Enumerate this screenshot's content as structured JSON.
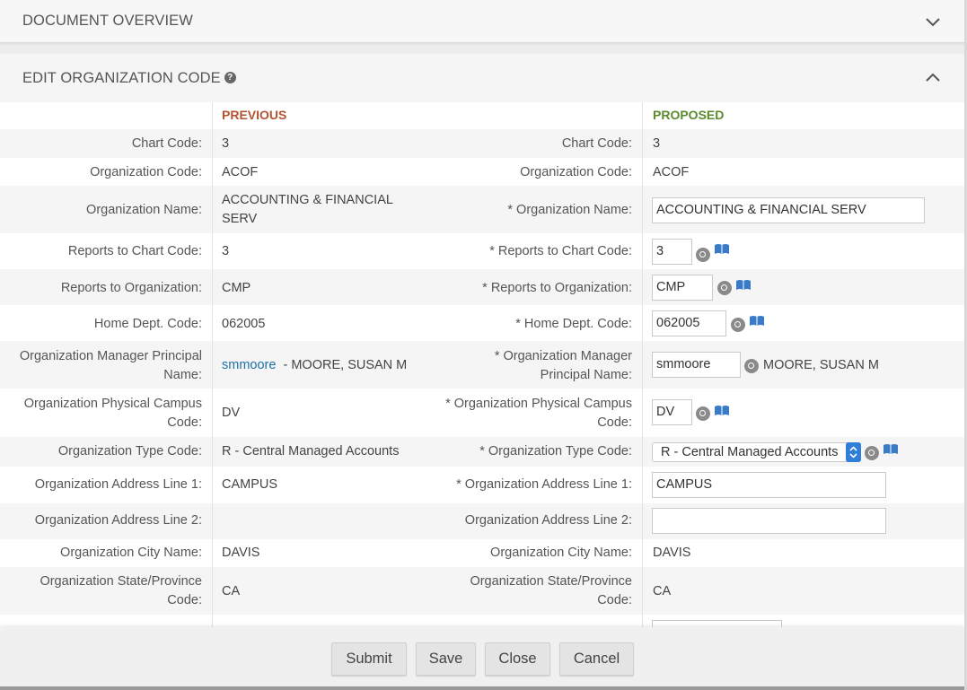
{
  "sections": {
    "document_overview": "DOCUMENT OVERVIEW",
    "edit_org": "EDIT ORGANIZATION CODE",
    "help_glyph": "?"
  },
  "columns": {
    "previous": "PREVIOUS",
    "proposed": "PROPOSED"
  },
  "rows": [
    {
      "label": "Chart Code:",
      "prev": "3",
      "plabel": "Chart Code:",
      "prop": "3"
    },
    {
      "label": "Organization Code:",
      "prev": "ACOF",
      "plabel": "Organization Code:",
      "prop": "ACOF"
    },
    {
      "label": "Organization Name:",
      "prev": "ACCOUNTING & FINANCIAL SERV",
      "plabel": "* Organization Name:",
      "prop": "ACCOUNTING & FINANCIAL SERV"
    },
    {
      "label": "Reports to Chart Code:",
      "prev": "3",
      "plabel": "* Reports to Chart Code:",
      "prop": "3"
    },
    {
      "label": "Reports to Organization:",
      "prev": "CMP",
      "plabel": "* Reports to Organization:",
      "prop": "CMP"
    },
    {
      "label": "Home Dept. Code:",
      "prev": "062005",
      "plabel": "* Home Dept. Code:",
      "prop": "062005"
    },
    {
      "label": "Organization Manager Principal Name:",
      "prev_link": "smmoore",
      "prev": "- MOORE, SUSAN M",
      "plabel": "* Organization Manager Principal Name:",
      "prop": "smmoore",
      "prop_extra": "MOORE, SUSAN M"
    },
    {
      "label": "Organization Physical Campus Code:",
      "prev": "DV",
      "plabel": "* Organization Physical Campus Code:",
      "prop": "DV"
    },
    {
      "label": "Organization Type Code:",
      "prev": "R - Central Managed Accounts",
      "plabel": "* Organization Type Code:",
      "prop": "R - Central Managed Accounts"
    },
    {
      "label": "Organization Address Line 1:",
      "prev": "CAMPUS",
      "plabel": "* Organization Address Line 1:",
      "prop": "CAMPUS"
    },
    {
      "label": "Organization Address Line 2:",
      "prev": "",
      "plabel": "Organization Address Line 2:",
      "prop": ""
    },
    {
      "label": "Organization City Name:",
      "prev": "DAVIS",
      "plabel": "Organization City Name:",
      "prop": "DAVIS"
    },
    {
      "label": "Organization State/Province Code:",
      "prev": "CA",
      "plabel": "Organization State/Province Code:",
      "prop": "CA"
    }
  ],
  "buttons": {
    "submit": "Submit",
    "save": "Save",
    "close": "Close",
    "cancel": "Cancel"
  },
  "colors": {
    "previous": "#b5522f",
    "proposed": "#5a8a2a",
    "link": "#1d6fa8"
  }
}
